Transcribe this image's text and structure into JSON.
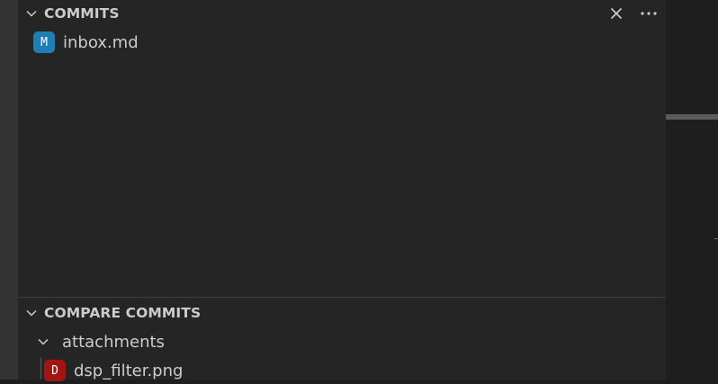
{
  "commits_section": {
    "title": "COMMITS",
    "files": [
      {
        "badge": "M",
        "badge_color": "#1f7fb5",
        "name": "inbox.md"
      }
    ]
  },
  "compare_section": {
    "title": "COMPARE COMMITS",
    "folder": {
      "name": "attachments"
    },
    "files": [
      {
        "badge": "D",
        "badge_color": "#a31515",
        "name": "dsp_filter.png"
      }
    ]
  },
  "icons": {
    "collapse_chevron": "chevron-down-icon",
    "close": "close-icon",
    "more": "ellipsis-icon"
  },
  "colors": {
    "sidebar_bg": "#252526",
    "editor_bg": "#1e1e1e",
    "text": "#cccccc",
    "modified_badge": "#1f7fb5",
    "deleted_badge": "#a31515"
  }
}
